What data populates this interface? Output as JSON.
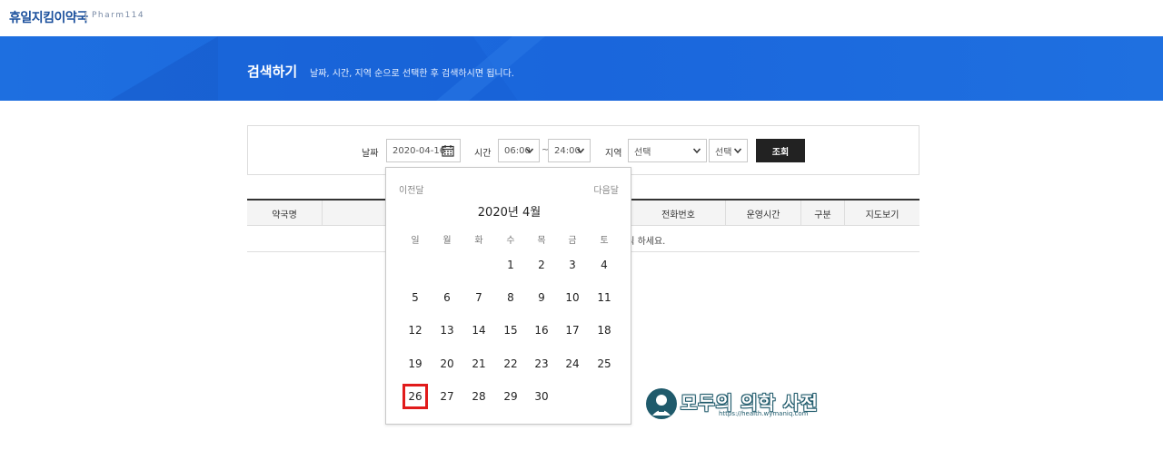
{
  "header": {
    "logo": "휴일지킴이약국",
    "logo_sub": "Pharm114"
  },
  "banner": {
    "title": "검색하기",
    "description": "날짜, 시간, 지역 순으로 선택한 후 검색하시면 됩니다."
  },
  "search": {
    "date_label": "날짜",
    "date_value": "2020-04-16",
    "time_label": "시간",
    "time_from": "06:00",
    "time_sep": "~",
    "time_to": "24:00",
    "region_label": "지역",
    "region_select": "선택",
    "subregion_select": "선택",
    "submit": "조회"
  },
  "table": {
    "headers": [
      "약국명",
      "전화번호",
      "운영시간",
      "구분",
      "지도보기"
    ],
    "empty_message_visible": "클릭 하세요."
  },
  "calendar": {
    "prev": "이전달",
    "next": "다음달",
    "title": "2020년 4월",
    "weekdays": [
      "일",
      "월",
      "화",
      "수",
      "목",
      "금",
      "토"
    ],
    "weeks": [
      [
        "",
        "",
        "",
        "1",
        "2",
        "3",
        "4"
      ],
      [
        "5",
        "6",
        "7",
        "8",
        "9",
        "10",
        "11"
      ],
      [
        "12",
        "13",
        "14",
        "15",
        "16",
        "17",
        "18"
      ],
      [
        "19",
        "20",
        "21",
        "22",
        "23",
        "24",
        "25"
      ],
      [
        "26",
        "27",
        "28",
        "29",
        "30",
        "",
        ""
      ]
    ],
    "highlighted_day": "26",
    "highlight_color": "#e11b1b"
  },
  "watermark": {
    "text": "모두의 의학 사전",
    "url": "https://health.wymaniq.com"
  },
  "colors": {
    "banner": "#1e6fe0",
    "logo": "#1a4f9c",
    "button": "#222222"
  }
}
